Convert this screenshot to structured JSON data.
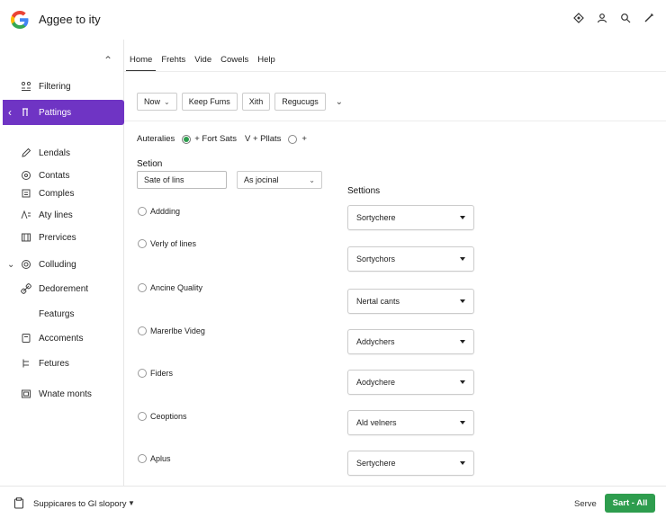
{
  "app": {
    "title": "Aggee to ity",
    "brand_color": "#2e9d4e",
    "accent_color": "#6f34c4"
  },
  "header_icons": [
    "lightbulb-icon",
    "user-icon",
    "search-icon",
    "edit-icon"
  ],
  "sidebar": {
    "items": [
      {
        "label": "Filtering",
        "icon": "filter-icon"
      },
      {
        "label": "Pattings",
        "icon": "pattings-icon",
        "active": true
      },
      {
        "label": "Lendals",
        "icon": "pencil-icon"
      },
      {
        "label": "Contats",
        "icon": "clock-icon"
      },
      {
        "label": "Comples",
        "icon": "list-icon"
      },
      {
        "label": "Aty lines",
        "icon": "lines-icon"
      },
      {
        "label": "Prervices",
        "icon": "preview-icon"
      },
      {
        "label": "Colluding",
        "icon": "gear-icon",
        "expanded": true
      },
      {
        "label": "Dedorement",
        "icon": "link-icon"
      },
      {
        "label": "Featurgs",
        "icon": ""
      },
      {
        "label": "Accoments",
        "icon": "comment-icon"
      },
      {
        "label": "Fetures",
        "icon": "tree-icon"
      },
      {
        "label": "Wnate monts",
        "icon": "image-icon"
      }
    ]
  },
  "tabs": [
    {
      "label": "Home",
      "active": true
    },
    {
      "label": "Frehts"
    },
    {
      "label": "Vide"
    },
    {
      "label": "Cowels"
    },
    {
      "label": "Help"
    }
  ],
  "toolbar": {
    "now_label": "Now",
    "keep_label": "Keep Fums",
    "xith_label": "Xith",
    "regucugs_label": "Regucugs"
  },
  "filter_row": {
    "label": "Auteralies",
    "option1": "+ Fort Sats",
    "option2": "V + Pllats",
    "option3": "+"
  },
  "section": {
    "title": "Setion",
    "input_value": "Sate of lins",
    "select_value": "As jocinal"
  },
  "options_title": "Settions",
  "options": [
    "Addding",
    "Verly of lines",
    "Ancine Quality",
    "Marerlbe Videg",
    "Fiders",
    "Ceoptions",
    "Aplus"
  ],
  "dropdowns": [
    "Sortychere",
    "Sortychors",
    "Nertal cants",
    "Addychers",
    "Aodychere",
    "Ald velners",
    "Sertychere"
  ],
  "bottom": {
    "status_text": "Suppicares to Gl slopory",
    "serve_label": "Serve",
    "primary_label": "Sart - All"
  }
}
